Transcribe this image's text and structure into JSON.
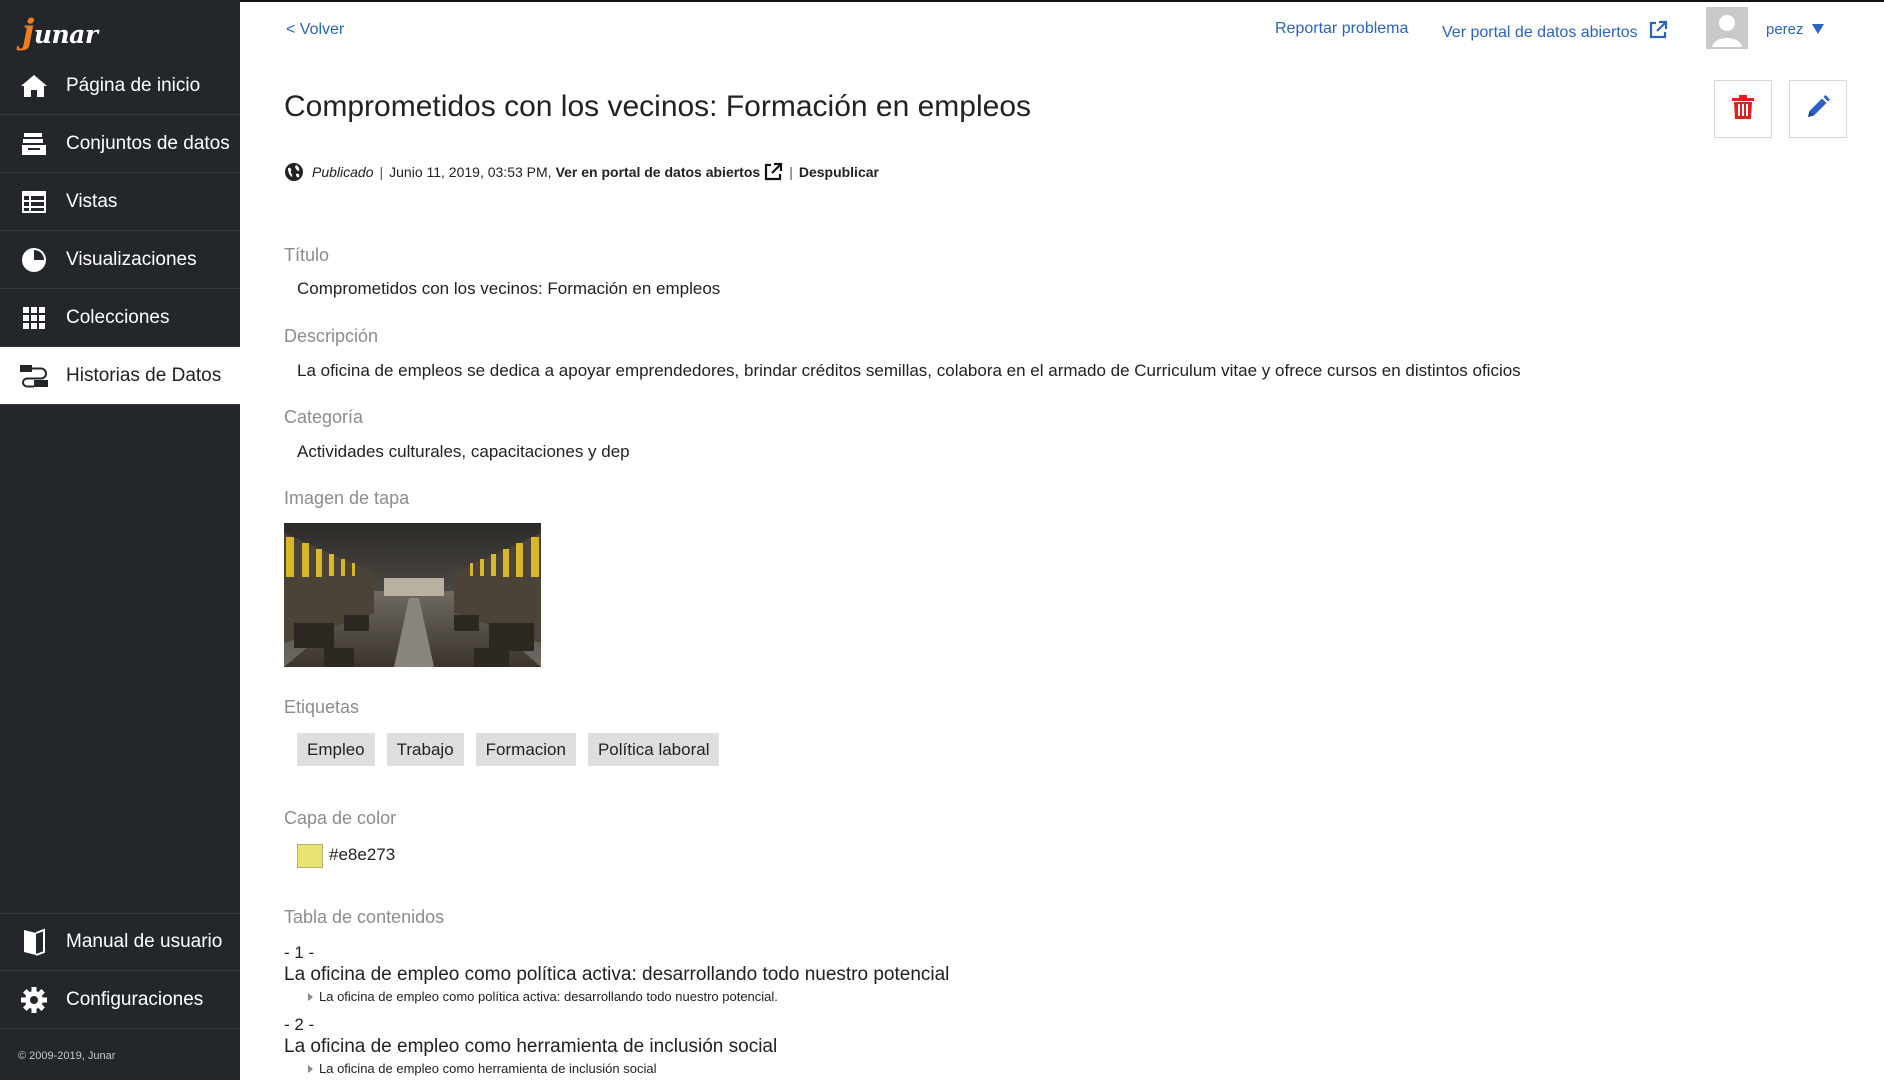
{
  "brand": {
    "logo_text": "junar"
  },
  "sidebar": {
    "items": [
      {
        "label": "Página de inicio",
        "icon": "home-icon"
      },
      {
        "label": "Conjuntos de datos",
        "icon": "datasets-icon"
      },
      {
        "label": "Vistas",
        "icon": "table-icon"
      },
      {
        "label": "Visualizaciones",
        "icon": "pie-chart-icon"
      },
      {
        "label": "Colecciones",
        "icon": "grid-icon"
      },
      {
        "label": "Historias de Datos",
        "icon": "data-story-icon",
        "active": true
      }
    ],
    "bottom_items": [
      {
        "label": "Manual de usuario",
        "icon": "book-icon"
      },
      {
        "label": "Configuraciones",
        "icon": "gear-icon"
      }
    ],
    "copyright": "© 2009-2019, Junar"
  },
  "topbar": {
    "back": "< Volver",
    "report": "Reportar problema",
    "portal": "Ver portal de datos abiertos",
    "username": "perez"
  },
  "header": {
    "title": "Comprometidos con los vecinos: Formación en empleos",
    "status": "Publicado",
    "date": "Junio 11, 2019, 03:53 PM,",
    "portal_link": "Ver en portal de datos abiertos",
    "unpublish": "Despublicar"
  },
  "fields": {
    "title_label": "Título",
    "title_value": "Comprometidos con los vecinos: Formación en empleos",
    "description_label": "Descripción",
    "description_value": "La oficina de empleos se dedica a apoyar emprendedores, brindar créditos semillas, colabora en el armado de Curriculum vitae y ofrece cursos en distintos oficios",
    "category_label": "Categoría",
    "category_value": "Actividades culturales, capacitaciones y dep",
    "cover_label": "Imagen de tapa",
    "tags_label": "Etiquetas",
    "tags": [
      "Empleo",
      "Trabajo",
      "Formacion",
      "Política laboral"
    ],
    "color_label": "Capa de color",
    "color_value": "#e8e273",
    "toc_label": "Tabla de contenidos"
  },
  "toc": [
    {
      "number": "- 1 -",
      "title": "La oficina de empleo como política activa: desarrollando todo nuestro potencial",
      "sub": "La oficina de empleo como política activa: desarrollando todo nuestro potencial."
    },
    {
      "number": "- 2 -",
      "title": "La oficina de empleo como herramienta de inclusión social",
      "sub": "La oficina de empleo como herramienta de inclusión social"
    }
  ],
  "colors": {
    "sidebar_bg": "#23272b",
    "link": "#2a63c7",
    "delete": "#e02020",
    "edit": "#2a63c7",
    "swatch": "#e8e273"
  }
}
